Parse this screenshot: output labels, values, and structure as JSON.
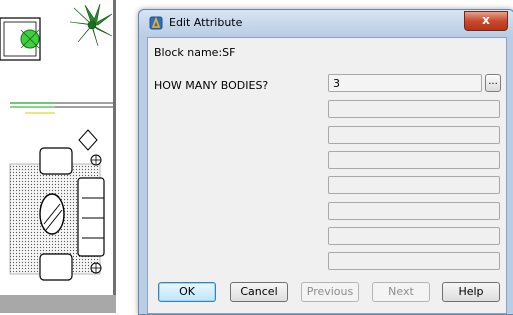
{
  "dialog": {
    "title": "Edit Attribute",
    "close_label": "x",
    "block_name_label": "Block name:SF",
    "prompt_label": "HOW MANY BODIES?",
    "prompt_value": "3",
    "ellipsis_label": "...",
    "empty_field_count": 7
  },
  "buttons": {
    "ok": "OK",
    "cancel": "Cancel",
    "previous": "Previous",
    "next": "Next",
    "help": "Help"
  },
  "colors": {
    "title_bar": "#b9cde5",
    "close_button": "#c84a2e",
    "client_background": "#f0f0f0"
  },
  "icons": {
    "title": "autocad-icon",
    "close": "close-icon"
  }
}
